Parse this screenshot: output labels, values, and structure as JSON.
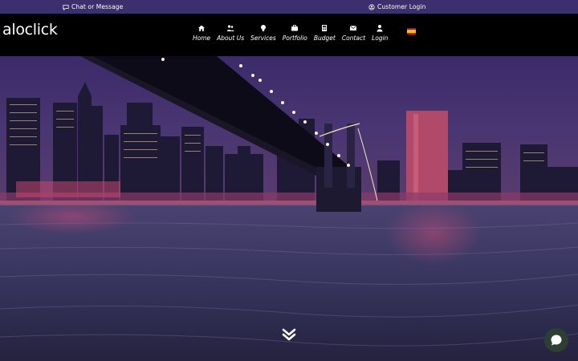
{
  "topbar": {
    "chat_label": "Chat or Message",
    "login_label": "Customer Login"
  },
  "brand": {
    "logo_text": "aloclick"
  },
  "nav": {
    "items": [
      {
        "label": "Home",
        "icon": "home-icon"
      },
      {
        "label": "About Us",
        "icon": "users-icon"
      },
      {
        "label": "Services",
        "icon": "lightbulb-icon"
      },
      {
        "label": "Portfolio",
        "icon": "briefcase-icon"
      },
      {
        "label": "Budget",
        "icon": "calculator-icon"
      },
      {
        "label": "Contact",
        "icon": "envelope-icon"
      },
      {
        "label": "Login",
        "icon": "user-icon"
      }
    ],
    "language_flag": "spain-flag-icon"
  },
  "colors": {
    "topbar_bg": "#3c2f6e",
    "navbar_bg": "#000000",
    "chat_widget_bg": "#2d3e33"
  }
}
